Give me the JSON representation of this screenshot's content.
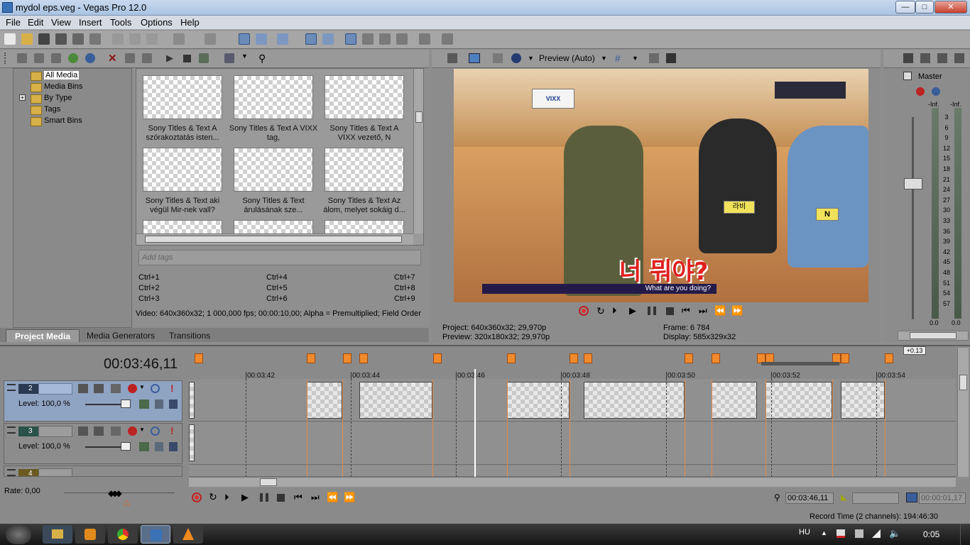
{
  "window": {
    "title": "mydol eps.veg - Vegas Pro 12.0",
    "min": "—",
    "max": "□",
    "close": "✕"
  },
  "menu": [
    "File",
    "Edit",
    "View",
    "Insert",
    "Tools",
    "Options",
    "Help"
  ],
  "explorer": {
    "tree": [
      "All Media",
      "Media Bins",
      "By Type",
      "Tags",
      "Smart Bins"
    ],
    "thumbs": [
      {
        "l1": "Sony Titles & Text A",
        "l2": "szórakoztatás isten..."
      },
      {
        "l1": "Sony Titles & Text A VIXX",
        "l2": "tag,"
      },
      {
        "l1": "Sony Titles & Text A",
        "l2": "VIXX vezető, N"
      },
      {
        "l1": "Sony Titles & Text aki",
        "l2": "végül Mir-nek vall?"
      },
      {
        "l1": "Sony Titles & Text",
        "l2": "árulásának sze..."
      },
      {
        "l1": "Sony Titles & Text Az",
        "l2": "álom, melyet sokáig d..."
      }
    ],
    "tags_placeholder": "Add tags",
    "shortcuts": [
      "Ctrl+1",
      "Ctrl+4",
      "Ctrl+7",
      "Ctrl+2",
      "Ctrl+5",
      "Ctrl+8",
      "Ctrl+3",
      "Ctrl+6",
      "Ctrl+9"
    ],
    "video_info": "Video: 640x360x32; 1 000,000 fps; 00:00:10,00; Alpha = Premultiplied; Field Order",
    "tabs": [
      "Project Media",
      "Media Generators",
      "Transitions"
    ]
  },
  "preview": {
    "mode": "Preview (Auto)",
    "project_label": "Project:",
    "project_value": "640x360x32; 29,970p",
    "preview_label": "Preview:",
    "preview_value": "320x180x32; 29,970p",
    "frame_label": "Frame:",
    "frame_value": "6 784",
    "display_label": "Display:",
    "display_value": "585x329x32",
    "subtitle_big": "너 뭐야?",
    "subtitle_small": "What are you doing?",
    "badge": "VIXX",
    "name_tag": "라비",
    "name_tag2": "N"
  },
  "master": {
    "label": "Master",
    "inf_left": "-Inf.",
    "inf_right": "-Inf.",
    "scale": [
      "3",
      "6",
      "9",
      "12",
      "15",
      "18",
      "21",
      "24",
      "27",
      "30",
      "33",
      "36",
      "39",
      "42",
      "45",
      "48",
      "51",
      "54",
      "57"
    ],
    "bottom_left": "0.0",
    "bottom_right": "0.0"
  },
  "timeline": {
    "current_time": "00:03:46,11",
    "zoom": "+0.13",
    "ruler": [
      "00:03:42",
      "00:03:44",
      "00:03:46",
      "00:03:48",
      "00:03:50",
      "00:03:52",
      "00:03:54"
    ],
    "tracks": [
      {
        "num": "2",
        "level": "Level: 100,0 %"
      },
      {
        "num": "3",
        "level": "Level: 100,0 %"
      },
      {
        "num": "4"
      }
    ],
    "rate": "Rate: 0,00",
    "time1": "00:03:46,11",
    "time2": "00:00:01,17",
    "record_time": "Record Time (2 channels): 194:46:30"
  },
  "taskbar": {
    "lang": "HU",
    "clock": "0:05"
  }
}
